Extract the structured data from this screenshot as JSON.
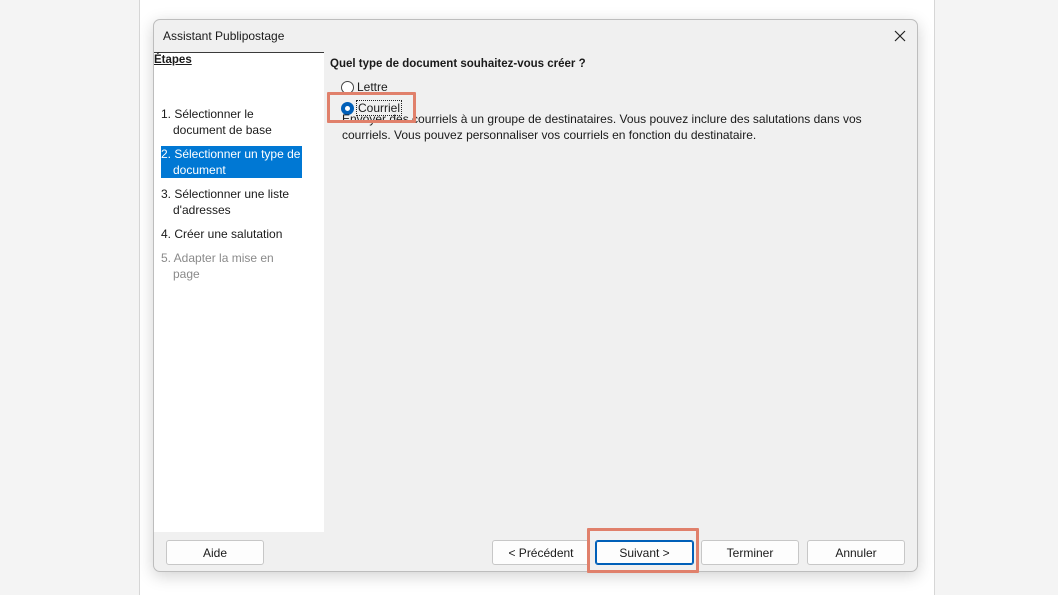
{
  "dialog": {
    "title": "Assistant Publipostage",
    "close_icon": "close-icon"
  },
  "steps": {
    "heading": "Étapes",
    "items": [
      {
        "label": "1. Sélectionner le document de base",
        "state": "normal"
      },
      {
        "label": "2. Sélectionner un type de document",
        "state": "active"
      },
      {
        "label": "3. Sélectionner une liste d'adresses",
        "state": "normal"
      },
      {
        "label": "4. Créer une salutation",
        "state": "normal"
      },
      {
        "label": "5. Adapter la mise en page",
        "state": "disabled"
      }
    ]
  },
  "content": {
    "question": "Quel type de document souhaitez-vous créer ?",
    "options": [
      {
        "label": "Lettre",
        "checked": false
      },
      {
        "label": "Courriel",
        "checked": true
      }
    ],
    "description": "Envoyer des courriels à un groupe de destinataires. Vous pouvez inclure des salutations dans vos courriels. Vous pouvez personnaliser vos courriels en fonction du destinataire."
  },
  "buttons": {
    "help": "Aide",
    "previous": "< Précédent",
    "next": "Suivant >",
    "finish": "Terminer",
    "cancel": "Annuler"
  },
  "colors": {
    "accent": "#0078d4",
    "highlight": "#e0806b"
  }
}
